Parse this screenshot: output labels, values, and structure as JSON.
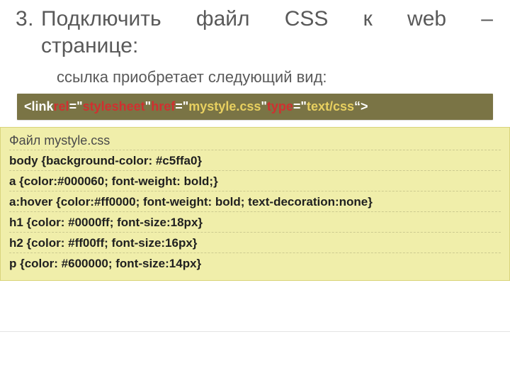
{
  "list_number": "3.",
  "heading_line1": "Подключить файл CSS к web –",
  "heading_line2": "странице:",
  "subheading": "ссылка приобретает следующий вид:",
  "code_tokens": [
    {
      "t": "<link ",
      "c": "w"
    },
    {
      "t": "rel",
      "c": "r"
    },
    {
      "t": "=\"",
      "c": "w"
    },
    {
      "t": "stylesheet",
      "c": "r"
    },
    {
      "t": "\" ",
      "c": "w"
    },
    {
      "t": "href",
      "c": "r"
    },
    {
      "t": "=\"",
      "c": "w"
    },
    {
      "t": "mystyle.css",
      "c": "y"
    },
    {
      "t": "\" ",
      "c": "w"
    },
    {
      "t": "type",
      "c": "r"
    },
    {
      "t": "=\"",
      "c": "w"
    },
    {
      "t": "text/css",
      "c": "y"
    },
    {
      "t": "“>",
      "c": "w"
    }
  ],
  "css_file_title": "Файл mystyle.css",
  "css_lines": [
    "body {background-color: #c5ffa0}",
    "a {color:#000060; font-weight: bold;}",
    "a:hover {color:#ff0000; font-weight: bold; text-decoration:none}",
    "h1 {color: #0000ff; font-size:18px}",
    "h2 {color: #ff00ff; font-size:16px}",
    "p {color: #600000; font-size:14px}"
  ]
}
